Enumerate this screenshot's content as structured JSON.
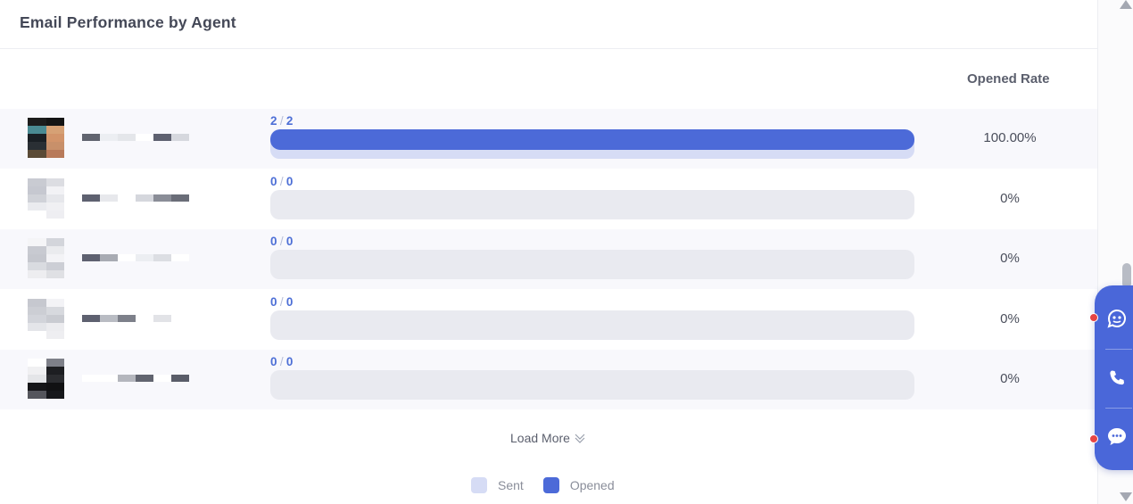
{
  "panel": {
    "title": "Email Performance by Agent",
    "column_header": "Opened Rate"
  },
  "rows": [
    {
      "count_opened": "2",
      "count_sent": "2",
      "opened_fraction": 1.0,
      "rate": "100.00%",
      "avatar": [
        "#1c1c1c",
        "#141414",
        "#4a8a92",
        "#d6a175",
        "#1a1f24",
        "#d2946a",
        "#2a2f34",
        "#c8906a",
        "#5a4a36",
        "#b87a5a"
      ],
      "name_blocks": [
        "#61646f",
        "#eceef2",
        "#e4e6ea",
        "#ffffff",
        "#5e6170",
        "#d6d8de"
      ]
    },
    {
      "count_opened": "0",
      "count_sent": "0",
      "opened_fraction": 0.0,
      "rate": "0%",
      "avatar": [
        "#c9cbd2",
        "#dcdde2",
        "#c6c8d0",
        "#f2f2f5",
        "#d0d2d8",
        "#e6e7eb",
        "#eaebef",
        "#f0f0f3",
        "#ffffff",
        "#eeeef2"
      ],
      "name_blocks": [
        "#5e6170",
        "#e7e8ec",
        "#ffffff",
        "#d5d7dd",
        "#8a8d97",
        "#6a6d78"
      ]
    },
    {
      "count_opened": "0",
      "count_sent": "0",
      "opened_fraction": 0.0,
      "rate": "0%",
      "avatar": [
        "#f5f5f7",
        "#d3d5db",
        "#c8cad1",
        "#eaebee",
        "#c5c7ce",
        "#f3f3f6",
        "#d9dbe0",
        "#ccced5",
        "#ededf0",
        "#dfe0e4"
      ],
      "name_blocks": [
        "#5e6170",
        "#a8abb3",
        "#ffffff",
        "#eceef2",
        "#dcdee3",
        "#ffffff"
      ]
    },
    {
      "count_opened": "0",
      "count_sent": "0",
      "opened_fraction": 0.0,
      "rate": "0%",
      "avatar": [
        "#c6c8cf",
        "#f3f3f6",
        "#ccced4",
        "#d7d9de",
        "#d2d4da",
        "#c9cbd1",
        "#e4e5e9",
        "#ececef",
        "#ffffff",
        "#eeeef1"
      ],
      "name_blocks": [
        "#5e6170",
        "#b9bcc3",
        "#7d808a",
        "#ffffff",
        "#e2e3e7",
        "#ffffff"
      ]
    },
    {
      "count_opened": "0",
      "count_sent": "0",
      "opened_fraction": 0.0,
      "rate": "0%",
      "avatar": [
        "#ffffff",
        "#7e8089",
        "#f0f0f2",
        "#1d1e22",
        "#e4e5e8",
        "#2b2c30",
        "#151518",
        "#111113",
        "#55565c",
        "#16171a"
      ],
      "name_blocks": [
        "#ffffff",
        "#ffffff",
        "#b4b6bd",
        "#61646f",
        "#ffffff",
        "#5a5d69"
      ]
    }
  ],
  "load_more": {
    "label": "Load More"
  },
  "legend": [
    {
      "label": "Sent",
      "color": "#d6dcf5"
    },
    {
      "label": "Opened",
      "color": "#4c6ad8"
    }
  ],
  "floating_toolbar": {
    "buttons": [
      "chatbot-icon",
      "phone-icon",
      "chat-bubble-icon"
    ],
    "accent": "#4a67d9"
  }
}
